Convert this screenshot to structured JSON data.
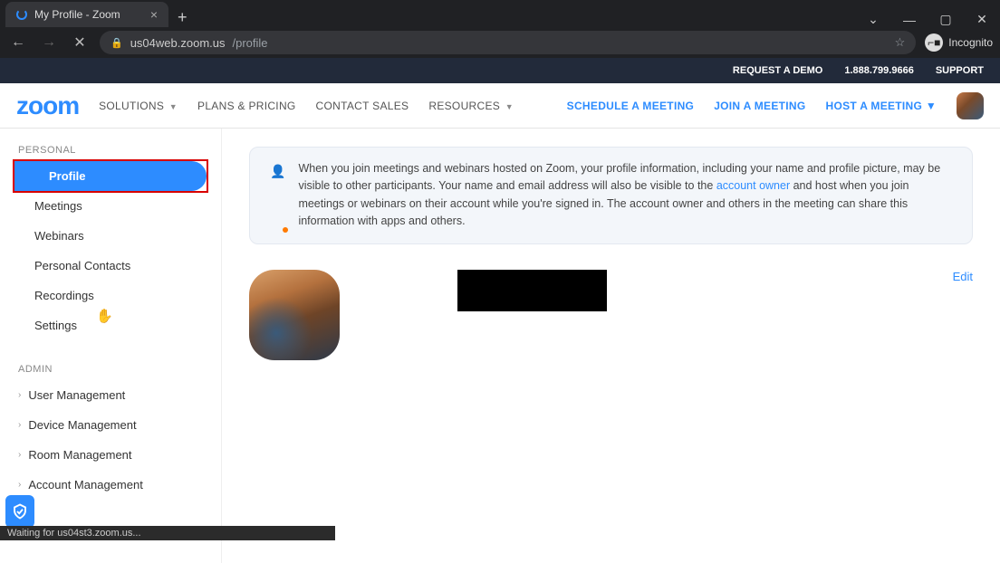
{
  "browser": {
    "tab_title": "My Profile - Zoom",
    "url_host": "us04web.zoom.us",
    "url_path": "/profile",
    "incognito_label": "Incognito",
    "status_text": "Waiting for us04st3.zoom.us..."
  },
  "banner": {
    "demo": "REQUEST A DEMO",
    "phone": "1.888.799.9666",
    "support": "SUPPORT"
  },
  "header": {
    "logo": "zoom",
    "solutions": "SOLUTIONS",
    "plans": "PLANS & PRICING",
    "contact": "CONTACT SALES",
    "resources": "RESOURCES",
    "schedule": "SCHEDULE A MEETING",
    "join": "JOIN A MEETING",
    "host": "HOST A MEETING"
  },
  "sidebar": {
    "personal_label": "PERSONAL",
    "admin_label": "ADMIN",
    "personal": [
      {
        "label": "Profile"
      },
      {
        "label": "Meetings"
      },
      {
        "label": "Webinars"
      },
      {
        "label": "Personal Contacts"
      },
      {
        "label": "Recordings"
      },
      {
        "label": "Settings"
      }
    ],
    "admin": [
      {
        "label": "User Management"
      },
      {
        "label": "Device Management"
      },
      {
        "label": "Room Management"
      },
      {
        "label": "Account Management"
      }
    ]
  },
  "notice": {
    "t1": "When you join meetings and webinars hosted on Zoom, your profile information, including your name and profile picture, may be visible to other participants. Your name and email address will also be visible to the ",
    "link": "account owner",
    "t2": " and host when you join meetings or webinars on their account while you're signed in. The account owner and others in the meeting can share this information with apps and others."
  },
  "profile": {
    "edit": "Edit"
  }
}
